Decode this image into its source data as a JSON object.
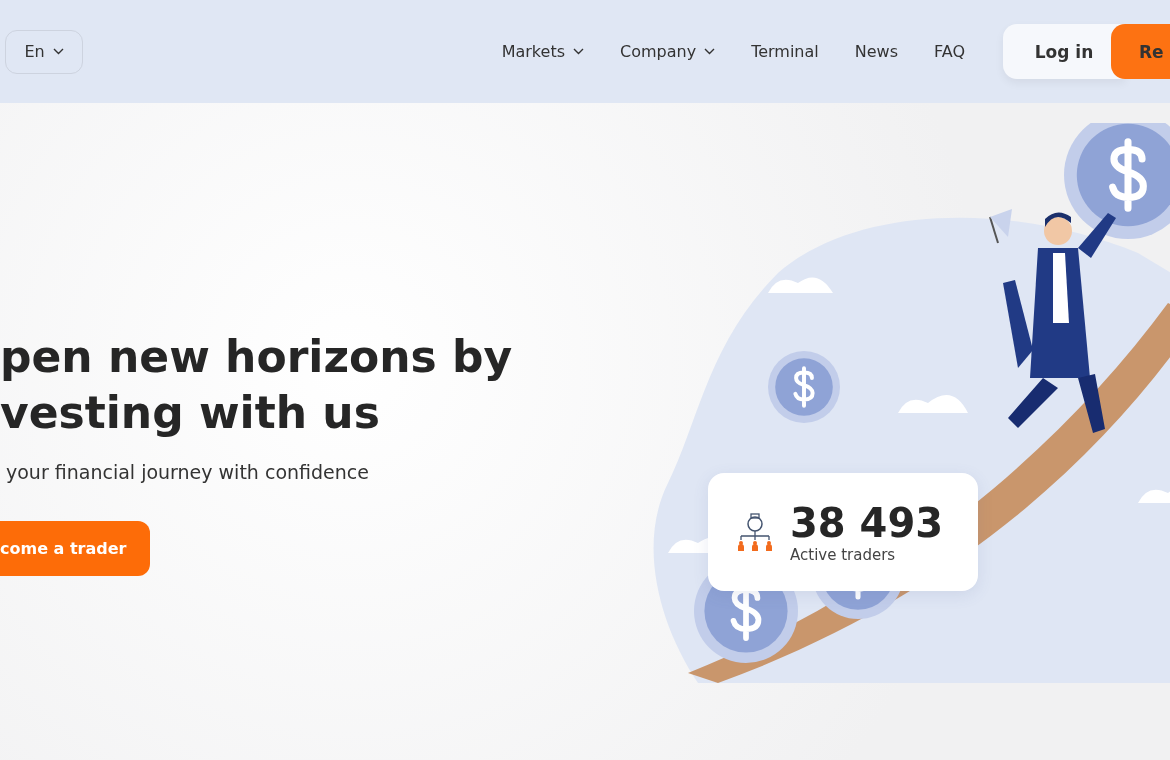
{
  "header": {
    "language": {
      "label": "En"
    },
    "nav": [
      {
        "label": "Markets",
        "kind": "dropdown"
      },
      {
        "label": "Company",
        "kind": "dropdown"
      },
      {
        "label": "Terminal",
        "kind": "link"
      },
      {
        "label": "News",
        "kind": "link"
      },
      {
        "label": "FAQ",
        "kind": "link"
      }
    ],
    "login": "Log in",
    "register": "Re"
  },
  "hero": {
    "title_lines": [
      "pen new horizons by",
      "vesting with us"
    ],
    "subtitle": "your financial journey with confidence",
    "cta": "come a trader",
    "stats": {
      "value": "38 493",
      "label": "Active traders"
    }
  }
}
